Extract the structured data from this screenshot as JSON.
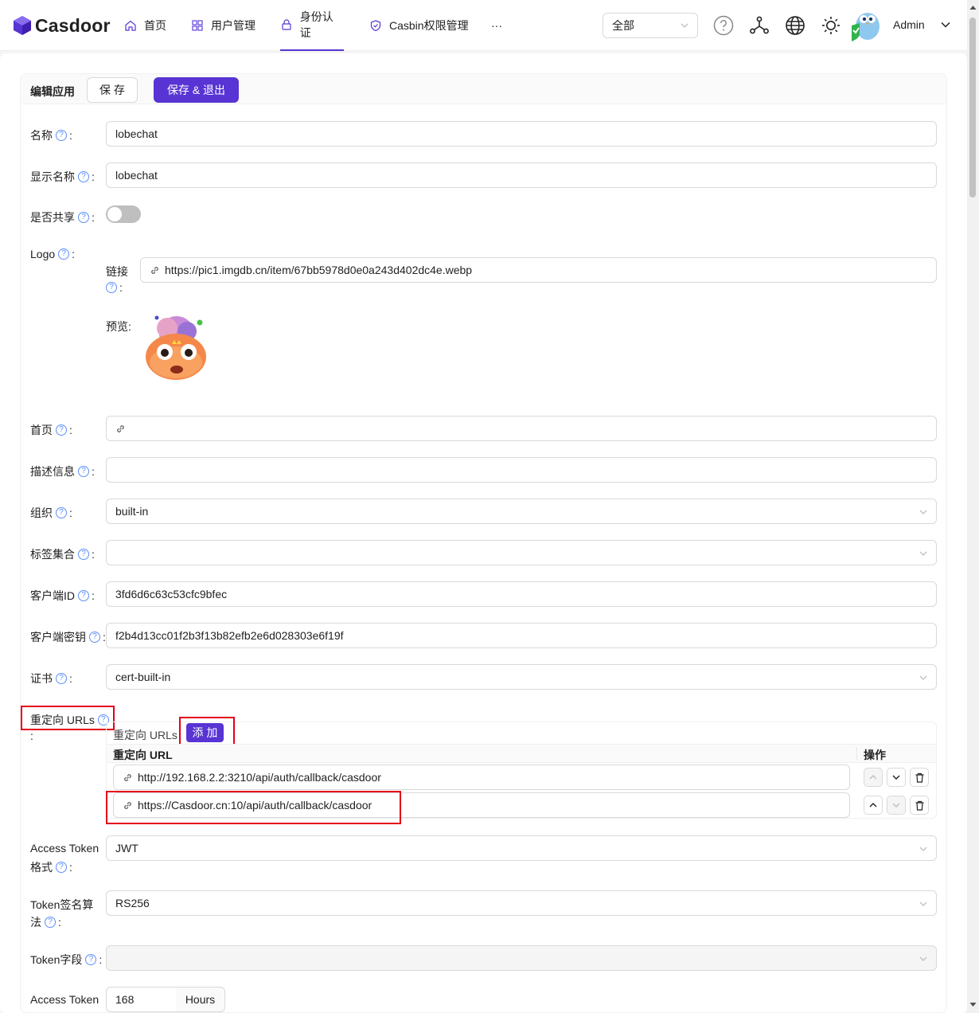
{
  "app": {
    "brand": "Casdoor",
    "accent_color": "#5734d3",
    "highlight_color": "#e3001b"
  },
  "nav": [
    {
      "label": "首页",
      "icon": "home-icon"
    },
    {
      "label": "用户管理",
      "icon": "grid-icon"
    },
    {
      "label": "身份认证",
      "icon": "lock-icon",
      "active": true
    },
    {
      "label": "Casbin权限管理",
      "icon": "shield-icon"
    },
    {
      "label": "···",
      "icon": "more-icon"
    }
  ],
  "org_select": {
    "value": "全部"
  },
  "user": {
    "name": "Admin"
  },
  "card": {
    "title": "编辑应用",
    "save_label": "保 存",
    "save_exit_label": "保存 & 退出"
  },
  "form": {
    "name": {
      "label": "名称",
      "value": "lobechat"
    },
    "display_name": {
      "label": "显示名称",
      "value": "lobechat"
    },
    "is_shared": {
      "label": "是否共享",
      "value": false
    },
    "logo": {
      "label": "Logo",
      "link_label": "链接",
      "url": "https://pic1.imgdb.cn/item/67bb5978d0e0a243d402dc4e.webp",
      "preview_label": "预览:"
    },
    "homepage": {
      "label": "首页",
      "value": ""
    },
    "description": {
      "label": "描述信息",
      "value": ""
    },
    "organization": {
      "label": "组织",
      "value": "built-in"
    },
    "tags": {
      "label": "标签集合",
      "value": ""
    },
    "client_id": {
      "label": "客户端ID",
      "value": "3fd6d6c63c53cfc9bfec"
    },
    "client_secret": {
      "label": "客户端密钥",
      "value": "f2b4d13cc01f2b3f13b82efb2e6d028303e6f19f"
    },
    "cert": {
      "label": "证书",
      "value": "cert-built-in"
    },
    "redirect_urls": {
      "label": "重定向 URLs",
      "table_title": "重定向 URLs",
      "add_label": "添 加",
      "col_url": "重定向 URL",
      "col_action": "操作",
      "rows": [
        "http://192.168.2.2:3210/api/auth/callback/casdoor",
        "https://Casdoor.cn:10/api/auth/callback/casdoor"
      ]
    },
    "access_token_format": {
      "label_line1": "Access Token",
      "label_line2": "格式",
      "value": "JWT"
    },
    "token_signing": {
      "label_line1": "Token签名算",
      "label_line2": "法",
      "value": "RS256"
    },
    "token_fields": {
      "label": "Token字段",
      "value": ""
    },
    "access_token_expire": {
      "label_line1": "Access Token",
      "value": "168",
      "unit": "Hours"
    }
  }
}
